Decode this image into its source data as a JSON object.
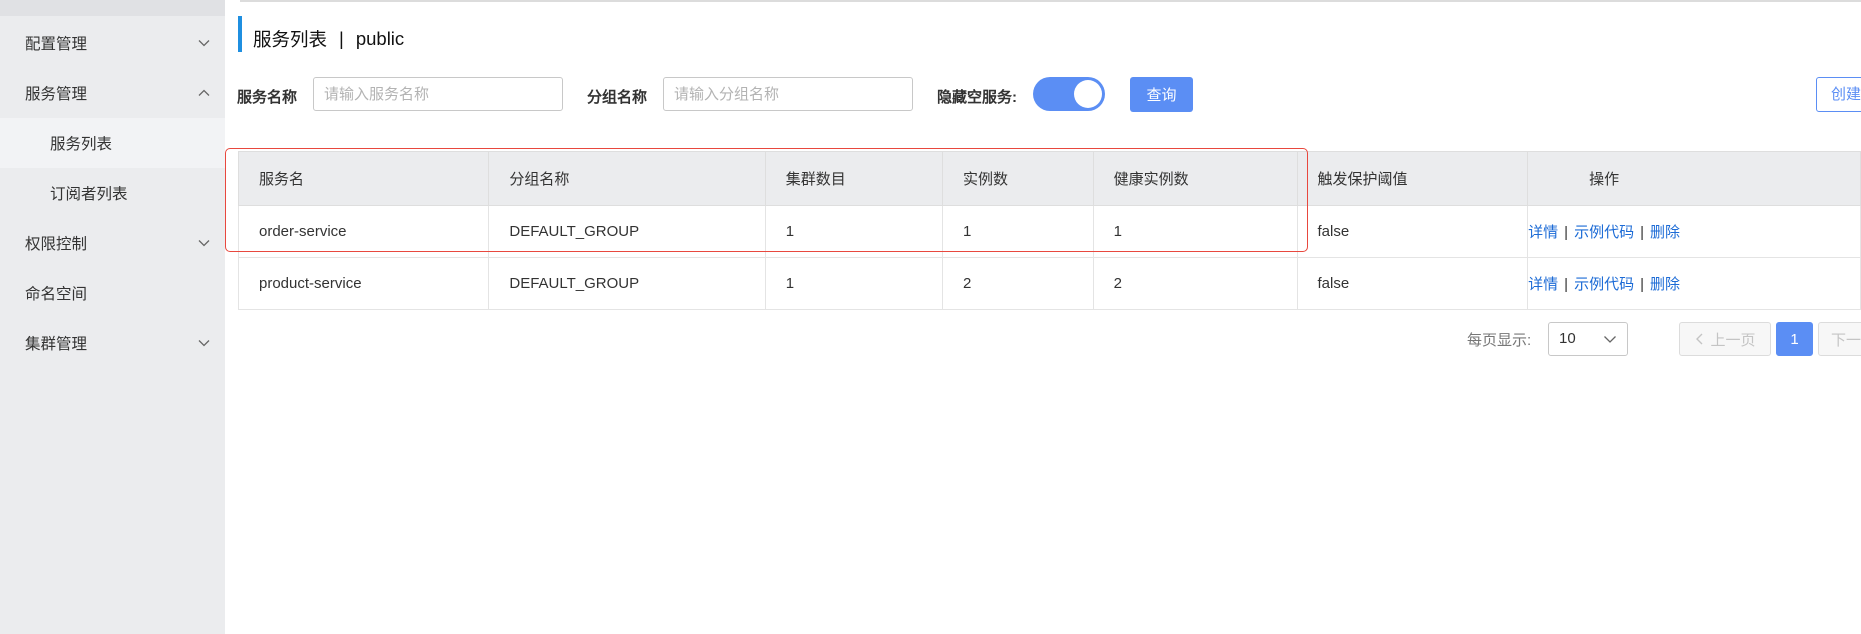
{
  "sidebar": {
    "items": [
      {
        "label": "配置管理",
        "expanded": false
      },
      {
        "label": "服务管理",
        "expanded": true
      },
      {
        "label": "服务列表",
        "active": true
      },
      {
        "label": "订阅者列表"
      },
      {
        "label": "权限控制",
        "expanded": false
      },
      {
        "label": "命名空间"
      },
      {
        "label": "集群管理",
        "expanded": false
      }
    ]
  },
  "header": {
    "title": "服务列表",
    "separator": "|",
    "namespace": "public"
  },
  "filters": {
    "service_name_label": "服务名称",
    "service_name_placeholder": "请输入服务名称",
    "group_name_label": "分组名称",
    "group_name_placeholder": "请输入分组名称",
    "hide_empty_label": "隐藏空服务:",
    "hide_empty_on": true,
    "query_label": "查询",
    "create_label": "创建服务"
  },
  "table": {
    "columns": [
      "服务名",
      "分组名称",
      "集群数目",
      "实例数",
      "健康实例数",
      "触发保护阈值",
      "操作"
    ],
    "rows": [
      {
        "service": "order-service",
        "group": "DEFAULT_GROUP",
        "clusters": "1",
        "instances": "1",
        "healthy": "1",
        "threshold": "false"
      },
      {
        "service": "product-service",
        "group": "DEFAULT_GROUP",
        "clusters": "1",
        "instances": "2",
        "healthy": "2",
        "threshold": "false"
      }
    ],
    "actions": {
      "detail": "详情",
      "sample": "示例代码",
      "delete": "删除",
      "sep": "|"
    }
  },
  "pagination": {
    "page_size_label": "每页显示:",
    "page_size": "10",
    "prev_label": "上一页",
    "current_page": "1",
    "next_label": "下一页"
  },
  "colors": {
    "accent": "#5b8ef4",
    "link": "#1c6bd6",
    "highlight_border": "#e8483e",
    "sidebar_bg": "#ebecee"
  }
}
